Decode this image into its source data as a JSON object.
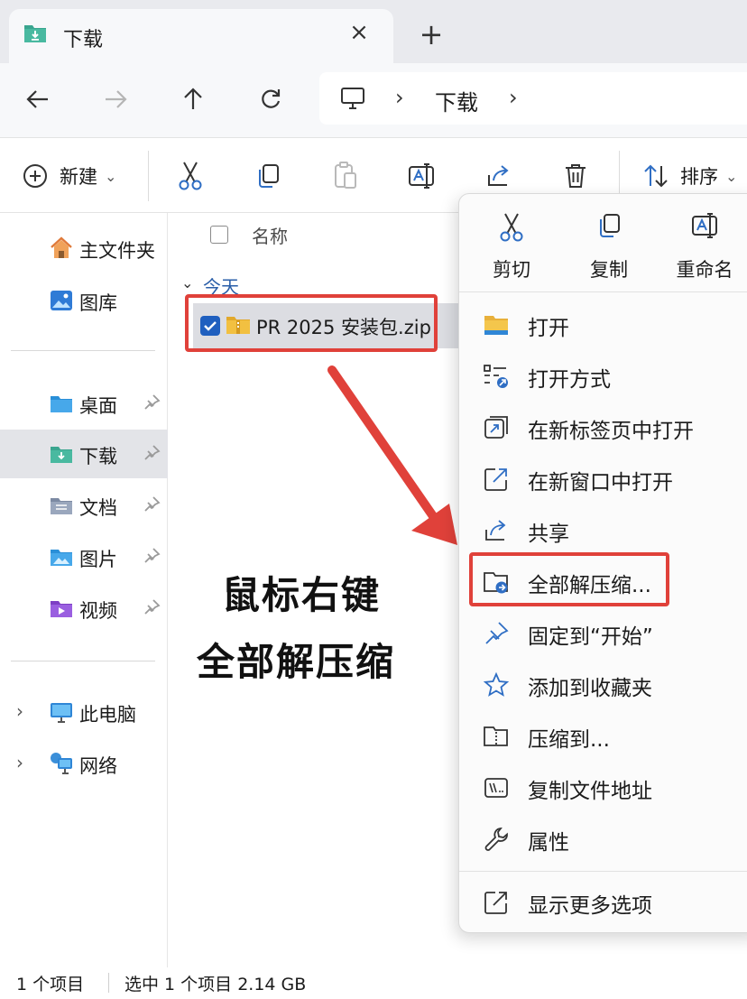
{
  "tab": {
    "title": "下载",
    "close": "×",
    "new_tab": "+"
  },
  "address": {
    "separator": "›",
    "current": "下载"
  },
  "toolbar": {
    "new_label": "新建",
    "sort_label": "排序",
    "caret": "⌄"
  },
  "sidebar": {
    "pinned": [
      {
        "label": "主文件夹",
        "icon": "home-icon"
      },
      {
        "label": "图库",
        "icon": "gallery-icon"
      }
    ],
    "quick": [
      {
        "label": "桌面",
        "icon": "desktop-folder-icon"
      },
      {
        "label": "下载",
        "icon": "downloads-folder-icon",
        "active": true
      },
      {
        "label": "文档",
        "icon": "documents-folder-icon"
      },
      {
        "label": "图片",
        "icon": "pictures-folder-icon"
      },
      {
        "label": "视频",
        "icon": "videos-folder-icon"
      }
    ],
    "devices": [
      {
        "label": "此电脑",
        "icon": "this-pc-icon"
      },
      {
        "label": "网络",
        "icon": "network-icon"
      }
    ],
    "chevron": "›"
  },
  "list": {
    "column_name": "名称",
    "group_label": "今天",
    "group_chevron": "⌄",
    "file": {
      "name": "PR 2025 安装包.zip",
      "checked": true
    }
  },
  "callout": {
    "line1": "鼠标右键",
    "line2": "全部解压缩"
  },
  "context_menu": {
    "top": [
      {
        "label": "剪切",
        "icon": "cut-icon"
      },
      {
        "label": "复制",
        "icon": "copy-icon"
      },
      {
        "label": "重命名",
        "icon": "rename-icon"
      }
    ],
    "items": [
      {
        "label": "打开",
        "icon": "folder-open-icon"
      },
      {
        "label": "打开方式",
        "icon": "open-with-icon"
      },
      {
        "label": "在新标签页中打开",
        "icon": "new-tab-icon"
      },
      {
        "label": "在新窗口中打开",
        "icon": "new-window-icon"
      },
      {
        "label": "共享",
        "icon": "share-icon"
      },
      {
        "label": "全部解压缩...",
        "icon": "extract-all-icon",
        "highlighted": true
      },
      {
        "label": "固定到“开始”",
        "icon": "pin-icon"
      },
      {
        "label": "添加到收藏夹",
        "icon": "star-icon"
      },
      {
        "label": "压缩到...",
        "icon": "compress-icon"
      },
      {
        "label": "复制文件地址",
        "icon": "copy-path-icon"
      },
      {
        "label": "属性",
        "icon": "wrench-icon"
      }
    ],
    "more": {
      "label": "显示更多选项",
      "icon": "more-options-icon"
    }
  },
  "status": {
    "items_count": "1 个项目",
    "selection": "选中 1 个项目  2.14 GB"
  },
  "colors": {
    "highlight_red": "#e0413a",
    "accent_blue": "#1f5fbf",
    "folder_yellow": "#f2c041"
  }
}
